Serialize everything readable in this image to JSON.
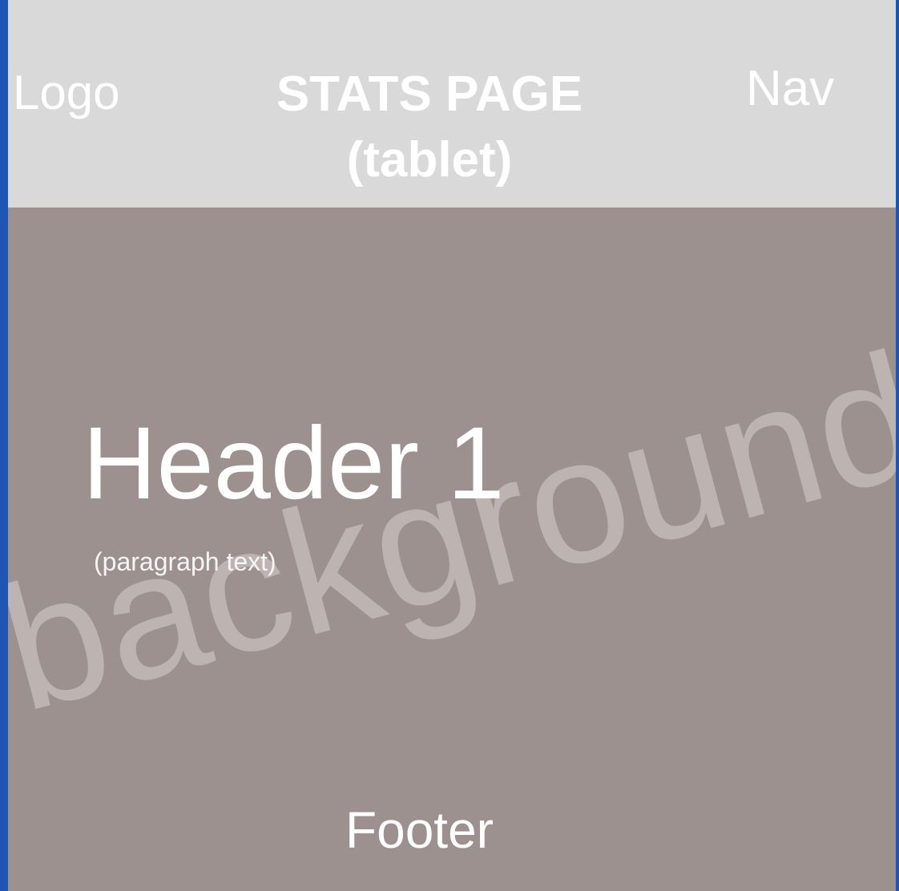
{
  "header": {
    "logo": "Logo",
    "title": "STATS PAGE\n(tablet)",
    "nav": "Nav"
  },
  "main": {
    "background_label": "background",
    "heading": "Header 1",
    "paragraph": "(paragraph text)"
  },
  "footer": {
    "label": "Footer"
  },
  "colors": {
    "frame_border": "#1f56b5",
    "header_background": "#d9d9d9",
    "page_background": "#9d9190",
    "watermark_text": "#bdb3b1",
    "text": "#ffffff"
  }
}
